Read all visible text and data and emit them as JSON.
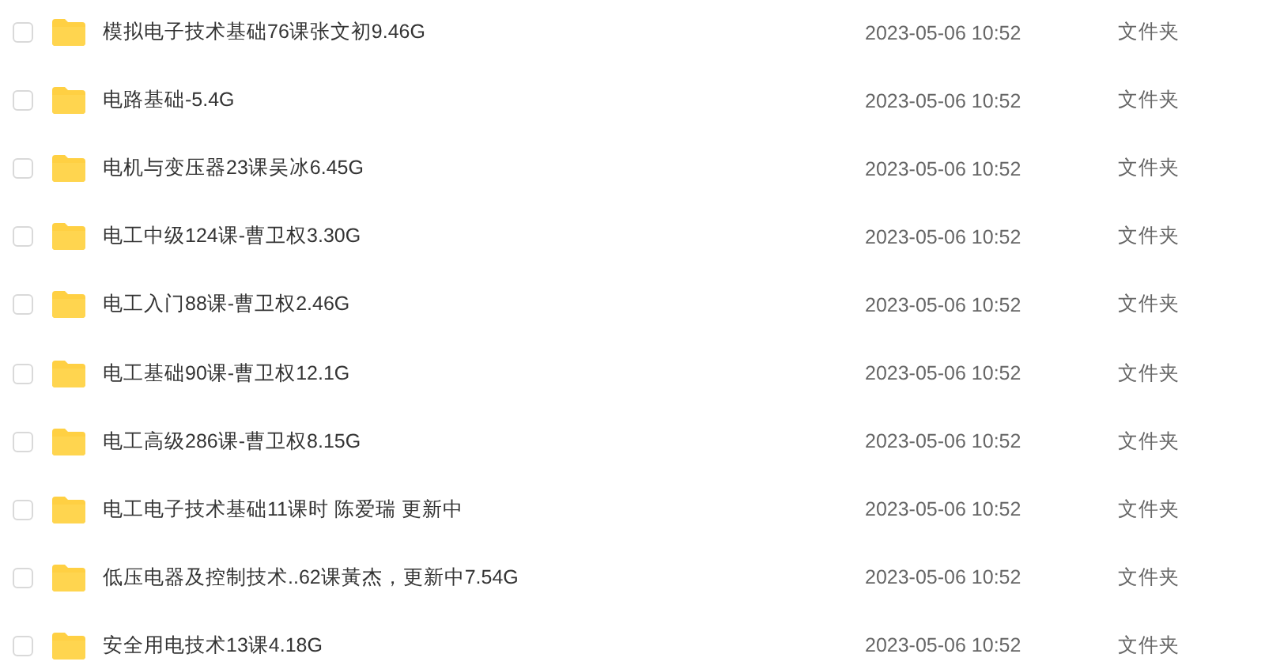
{
  "files": [
    {
      "name": "模拟电子技术基础76课张文初9.46G",
      "modified": "2023-05-06 10:52",
      "type": "文件夹",
      "checked": false
    },
    {
      "name": "电路基础-5.4G",
      "modified": "2023-05-06 10:52",
      "type": "文件夹",
      "checked": false
    },
    {
      "name": "电机与变压器23课吴冰6.45G",
      "modified": "2023-05-06 10:52",
      "type": "文件夹",
      "checked": false
    },
    {
      "name": "电工中级124课-曹卫权3.30G",
      "modified": "2023-05-06 10:52",
      "type": "文件夹",
      "checked": false
    },
    {
      "name": "电工入门88课-曹卫权2.46G",
      "modified": "2023-05-06 10:52",
      "type": "文件夹",
      "checked": false
    },
    {
      "name": "电工基础90课-曹卫权12.1G",
      "modified": "2023-05-06 10:52",
      "type": "文件夹",
      "checked": false
    },
    {
      "name": "电工高级286课-曹卫权8.15G",
      "modified": "2023-05-06 10:52",
      "type": "文件夹",
      "checked": false
    },
    {
      "name": "电工电子技术基础11课时 陈爱瑞 更新中",
      "modified": "2023-05-06 10:52",
      "type": "文件夹",
      "checked": false
    },
    {
      "name": "低压电器及控制技术..62课黃杰，更新中7.54G",
      "modified": "2023-05-06 10:52",
      "type": "文件夹",
      "checked": false
    },
    {
      "name": "安全用电技术13课4.18G",
      "modified": "2023-05-06 10:52",
      "type": "文件夹",
      "checked": false
    }
  ]
}
